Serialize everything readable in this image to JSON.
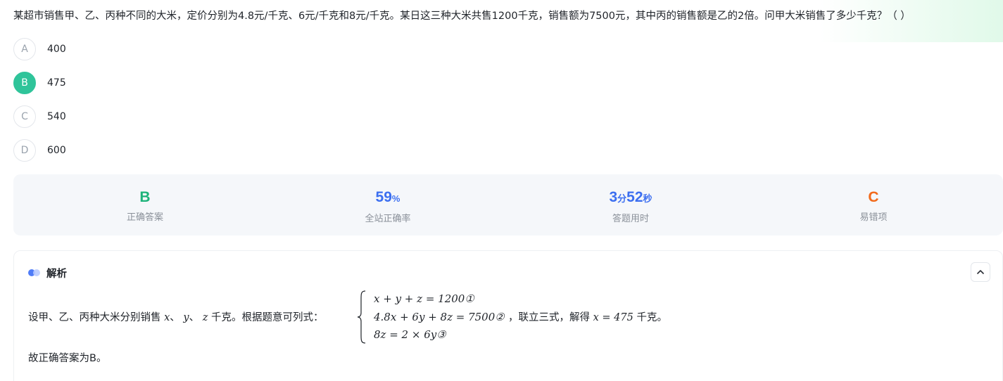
{
  "question": {
    "text": "某超市销售甲、乙、丙种不同的大米，定价分别为4.8元/千克、6元/千克和8元/千克。某日这三种大米共售1200千克，销售额为7500元，其中丙的销售额是乙的2倍。问甲大米销售了多少千克？（ ）"
  },
  "options": [
    {
      "letter": "A",
      "value": "400",
      "selected": false
    },
    {
      "letter": "B",
      "value": "475",
      "selected": true
    },
    {
      "letter": "C",
      "value": "540",
      "selected": false
    },
    {
      "letter": "D",
      "value": "600",
      "selected": false
    }
  ],
  "stats": {
    "correct_answer": {
      "value": "B",
      "label": "正确答案"
    },
    "accuracy": {
      "value": "59",
      "unit": "%",
      "label": "全站正确率"
    },
    "time": {
      "min": "3",
      "min_unit": "分",
      "sec": "52",
      "sec_unit": "秒",
      "label": "答题用时"
    },
    "error_prone": {
      "value": "C",
      "label": "易错项"
    }
  },
  "analysis": {
    "title": "解析",
    "line1_prefix": "设甲、乙、丙种大米分别销售",
    "var_x": "x",
    "sep1": "、",
    "var_y": "y",
    "sep2": "、",
    "var_z": "z",
    "line1_mid": "千克。根据题意可列式：",
    "eq1": "x + y + z = 1200①",
    "eq2": "4.8x + 6y + 8z = 7500②",
    "eq3": "8z = 2 × 6y③",
    "line1_suffix": "，联立三式，解得",
    "result": "x = 475",
    "line1_end": "千克。",
    "conclusion": "故正确答案为B。"
  },
  "colors": {
    "selected_option": "#2fc49a",
    "answer_green": "#1db37a",
    "accuracy_blue": "#3c6ff0",
    "error_orange": "#f26a1b",
    "stats_bg": "#f5f7fa"
  }
}
